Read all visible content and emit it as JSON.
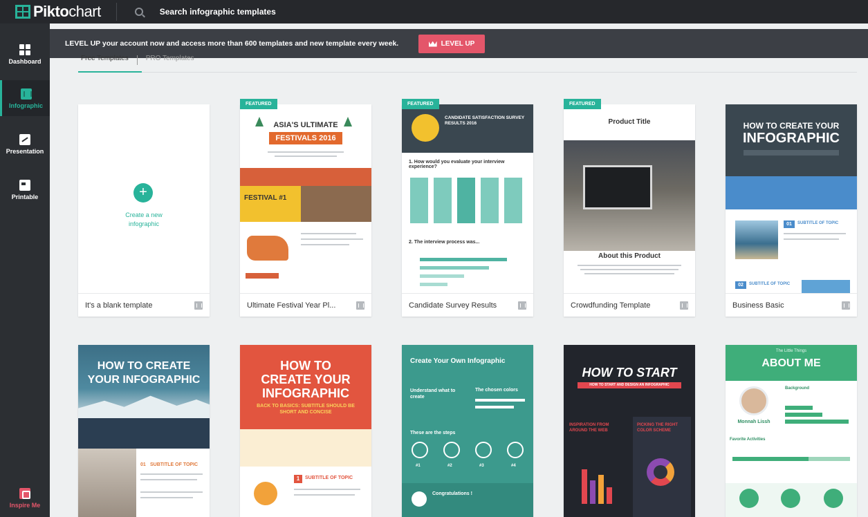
{
  "app": {
    "logo_bold": "Pikto",
    "logo_thin": "chart",
    "search_label": "Search infographic templates"
  },
  "sidebar": {
    "items": [
      {
        "label": "Dashboard",
        "icon": "dashboard-icon"
      },
      {
        "label": "Infographic",
        "icon": "infographic-icon"
      },
      {
        "label": "Presentation",
        "icon": "presentation-icon"
      },
      {
        "label": "Printable",
        "icon": "printable-icon"
      }
    ],
    "inspire_label": "Inspire Me"
  },
  "banner": {
    "text": "LEVEL UP your account now and access more than 600 templates and new template every week.",
    "button_label": "LEVEL UP"
  },
  "tabs": [
    {
      "label": "Free Templates"
    },
    {
      "label": "PRO Templates"
    }
  ],
  "cards": [
    {
      "title": "It's a blank template",
      "cta": "Create a new infographic"
    },
    {
      "title": "Ultimate Festival Year Pl...",
      "badge": "FEATURED",
      "head1": "ASIA'S ULTIMATE",
      "head2": "FESTIVALS 2016",
      "sub": "FESTIVAL #1"
    },
    {
      "title": "Candidate Survey Results",
      "badge": "FEATURED",
      "head1": "CANDIDATE SATISFACTION SURVEY RESULTS 2016",
      "q1": "1. How would you evaluate your interview experience?",
      "q2": "2. The interview process was..."
    },
    {
      "title": "Crowdfunding Template",
      "badge": "FEATURED",
      "head1": "Product Title",
      "head2": "About this Product"
    },
    {
      "title": "Business Basic",
      "head1": "HOW TO CREATE YOUR",
      "head2": "INFOGRAPHIC",
      "topic1": "01",
      "topic1_label": "SUBTITLE OF TOPIC",
      "topic2": "02",
      "topic2_label": "SUBTITLE OF TOPIC"
    },
    {
      "head1": "HOW TO CREATE",
      "head2": "YOUR INFOGRAPHIC",
      "topic": "01",
      "topic_label": "SUBTITLE OF TOPIC"
    },
    {
      "head1": "HOW TO",
      "head2": "CREATE YOUR",
      "head3": "INFOGRAPHIC",
      "sub": "BACK TO BASICS: SUBTITLE SHOULD BE SHORT AND CONCISE",
      "topic": "1",
      "topic_label": "SUBTITLE OF TOPIC"
    },
    {
      "head1": "Create Your Own Infographic",
      "col1": "Understand what to create",
      "col2": "The chosen colors",
      "steps": "These are the steps",
      "step_nums": [
        "#1",
        "#2",
        "#3",
        "#4"
      ],
      "congrats": "Congratulations !"
    },
    {
      "head1": "HOW TO START",
      "sub": "HOW TO START AND DESIGN AN INFOGRAPHIC",
      "col1": "INSPIRATION FROM AROUND THE WEB",
      "col2": "PICKING THE RIGHT COLOR SCHEME"
    },
    {
      "head0": "The Little Things",
      "head1": "ABOUT ME",
      "name": "Monnah Lissh",
      "bg_label": "Background",
      "fav": "Favorite Activities"
    }
  ],
  "colors": {
    "accent": "#28b39a",
    "level_up": "#e4566a",
    "topbar": "#26282c",
    "sidebar": "#2c2f33"
  }
}
